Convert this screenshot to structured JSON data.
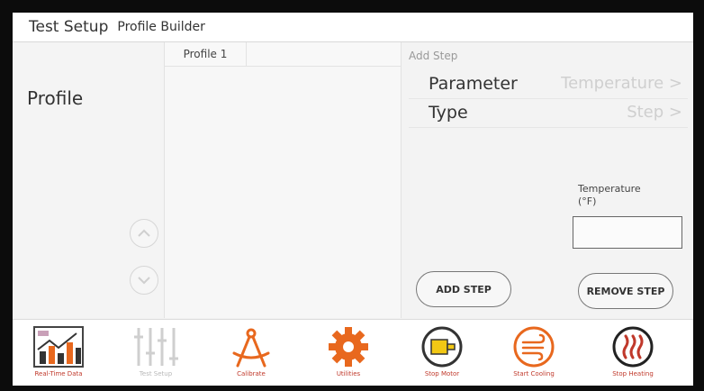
{
  "header": {
    "title": "Test Setup",
    "subtitle": "Profile Builder"
  },
  "left": {
    "profile_label": "Profile"
  },
  "middle": {
    "column_header": "Profile 1"
  },
  "right": {
    "add_step_label": "Add Step",
    "parameter": {
      "label": "Parameter",
      "value": "Temperature",
      "chevron": ">"
    },
    "type": {
      "label": "Type",
      "value": "Step",
      "chevron": ">"
    },
    "temperature_label": "Temperature",
    "temperature_unit": "(°F)",
    "temperature_value": "",
    "add_step_button": "ADD STEP",
    "remove_step_button": "REMOVE STEP"
  },
  "toolbar": [
    {
      "label": "Real-Time Data",
      "icon": "chart-icon",
      "enabled": true
    },
    {
      "label": "Test Setup",
      "icon": "sliders-icon",
      "enabled": false
    },
    {
      "label": "Calibrate",
      "icon": "compass-icon",
      "enabled": true
    },
    {
      "label": "Utilities",
      "icon": "gear-icon",
      "enabled": true
    },
    {
      "label": "Stop Motor",
      "icon": "motor-icon",
      "enabled": true
    },
    {
      "label": "Start Cooling",
      "icon": "cooling-icon",
      "enabled": true
    },
    {
      "label": "Stop Heating",
      "icon": "heating-icon",
      "enabled": true
    }
  ],
  "colors": {
    "accent": "#c0392b",
    "orange": "#e8681e",
    "motor_yellow": "#f2c814"
  }
}
